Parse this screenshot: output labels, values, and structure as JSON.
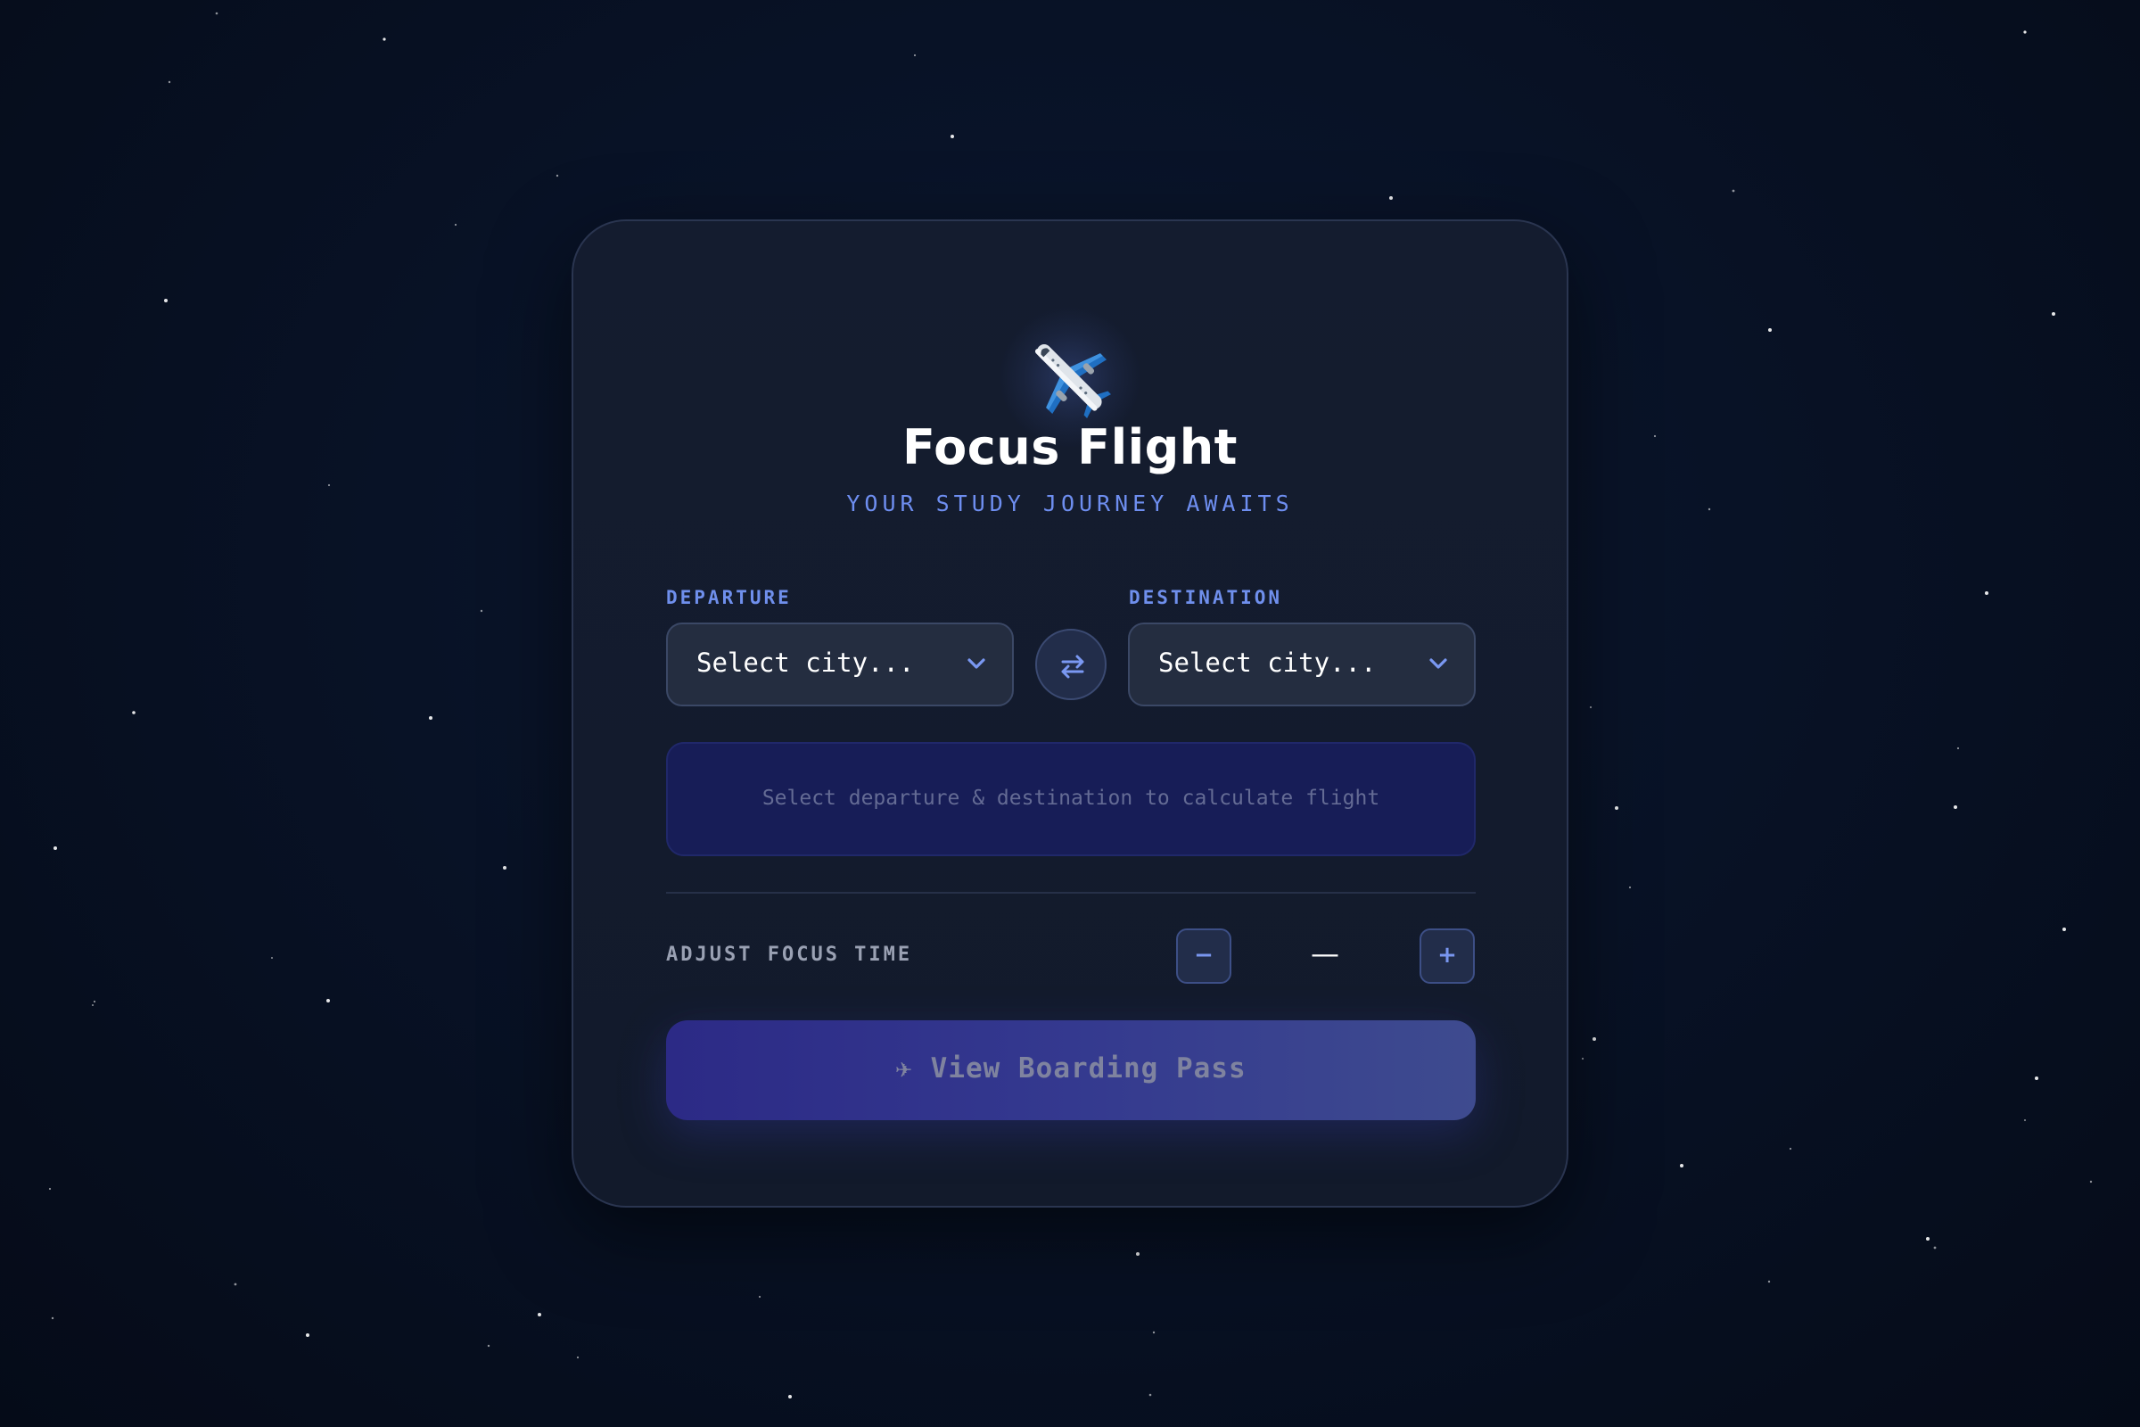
{
  "app": {
    "title": "Focus Flight",
    "subtitle": "YOUR STUDY JOURNEY AWAITS",
    "logo_icon": "airplane-icon"
  },
  "route": {
    "departure": {
      "label": "DEPARTURE",
      "placeholder": "Select city..."
    },
    "destination": {
      "label": "DESTINATION",
      "placeholder": "Select city..."
    },
    "swap_icon": "swap-arrows-icon"
  },
  "info": {
    "message": "Select departure & destination to calculate flight"
  },
  "focus_time": {
    "label": "ADJUST FOCUS TIME",
    "decrement_label": "−",
    "increment_label": "+",
    "value": "—"
  },
  "actions": {
    "boarding_pass_label": "✈ View Boarding Pass"
  },
  "colors": {
    "background": "#081226",
    "card": "#141c2f",
    "accent": "#6e8ef0",
    "info_box": "#171d57",
    "primary_button_start": "#2c2a86",
    "primary_button_end": "#3e4b8f"
  }
}
